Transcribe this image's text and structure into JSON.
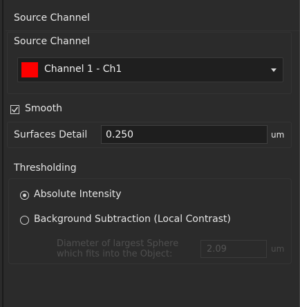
{
  "panel": {
    "header_title": "Source Channel"
  },
  "source_channel": {
    "label": "Source Channel",
    "selected": "Channel 1 - Ch1",
    "swatch_color": "#ff0000"
  },
  "smooth": {
    "label": "Smooth",
    "checked": true
  },
  "surfaces_detail": {
    "label": "Surfaces Detail",
    "value": "0.250",
    "unit": "um"
  },
  "thresholding": {
    "label": "Thresholding",
    "options": [
      {
        "label": "Absolute Intensity",
        "selected": true
      },
      {
        "label": "Background Subtraction (Local Contrast)",
        "selected": false
      }
    ],
    "diameter": {
      "label_line1": "Diameter of largest Sphere",
      "label_line2": "which fits into the Object:",
      "value": "2.09",
      "unit": "um",
      "enabled": false
    }
  }
}
